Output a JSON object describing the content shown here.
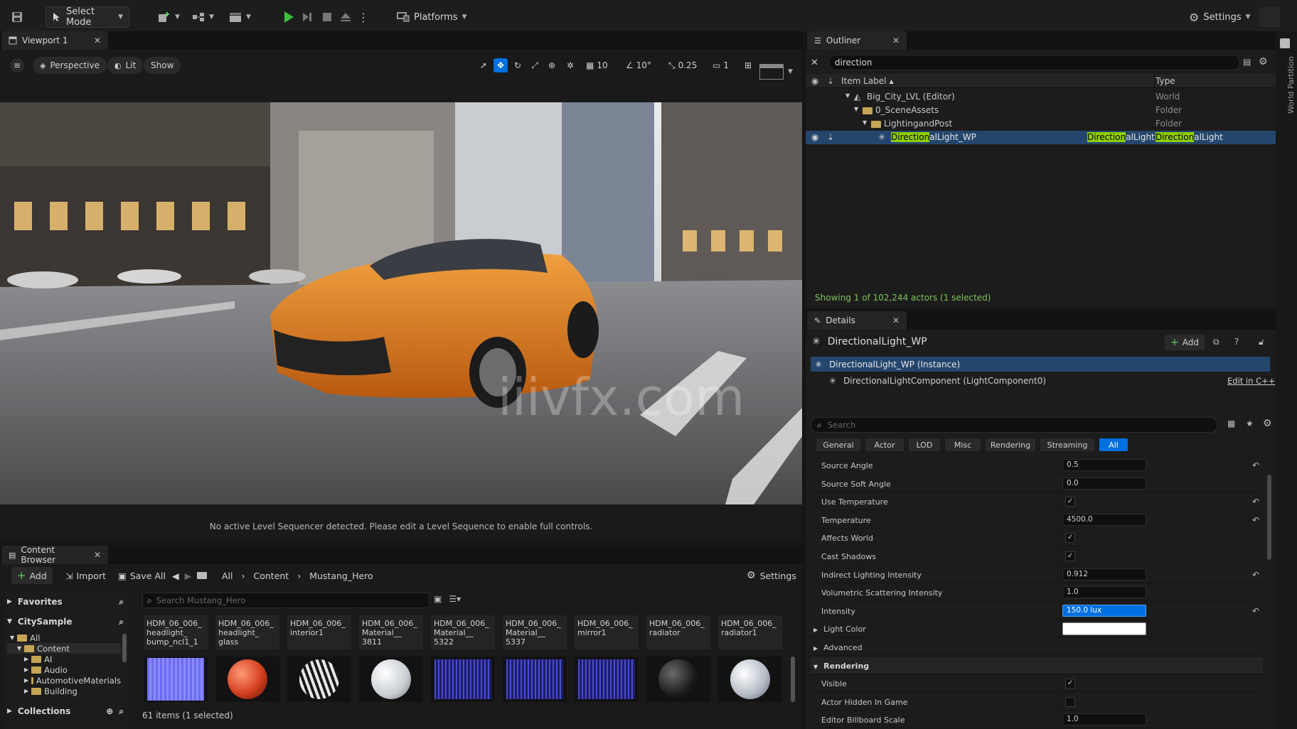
{
  "toolbar": {
    "select_mode": "Select Mode",
    "platforms": "Platforms",
    "settings": "Settings"
  },
  "viewport": {
    "tab": "Viewport 1",
    "perspective": "Perspective",
    "lit": "Lit",
    "show": "Show",
    "grid_snap": "10",
    "angle_snap": "10°",
    "scale_snap": "0.25",
    "camera_speed": "1",
    "watermark": "iiivfx.com",
    "message": "No active Level Sequencer detected. Please edit a Level Sequence to enable full controls."
  },
  "content_browser": {
    "tab": "Content Browser",
    "add": "Add",
    "import": "Import",
    "save_all": "Save All",
    "breadcrumb": [
      "All",
      "Content",
      "Mustang_Hero"
    ],
    "settings": "Settings",
    "favorites": "Favorites",
    "project": "CitySample",
    "search_placeholder": "Search Mustang_Hero",
    "tree": [
      "All",
      "Content",
      "AI",
      "Audio",
      "AutomotiveMaterials",
      "Building"
    ],
    "collections": "Collections",
    "status": "61 items (1 selected)",
    "assets": [
      {
        "label": "HDM_06_006_ headlight_ bump_ncl1_1",
        "thumb": "blue-tex"
      },
      {
        "label": "HDM_06_006_ headlight_ glass",
        "thumb": "red-sphere"
      },
      {
        "label": "HDM_06_006_ interior1",
        "thumb": "pattern-sphere"
      },
      {
        "label": "HDM_06_006_ Material__ 3811",
        "thumb": "white-sphere"
      },
      {
        "label": "HDM_06_006_ Material__ 5322",
        "thumb": "grid-tex"
      },
      {
        "label": "HDM_06_006_ Material__ 5337",
        "thumb": "grid-tex"
      },
      {
        "label": "HDM_06_006_ mirror1",
        "thumb": "grid-tex"
      },
      {
        "label": "HDM_06_006_ radiator",
        "thumb": "dark-sphere"
      },
      {
        "label": "HDM_06_006_ radiator1",
        "thumb": "grey-sphere"
      }
    ]
  },
  "outliner": {
    "tab": "Outliner",
    "search_value": "direction",
    "col_label": "Item Label",
    "col_type": "Type",
    "rows": [
      {
        "label": "Big_City_LVL (Editor)",
        "type": "World"
      },
      {
        "label": "0_SceneAssets",
        "type": "Folder"
      },
      {
        "label": "LightingandPost",
        "type": "Folder"
      }
    ],
    "selected": {
      "label_match": "Direction",
      "label_rest": "alLight_WP",
      "col2_match": "Direction",
      "col2_rest": "alLight",
      "type_match": "Direction",
      "type_rest": "alLight"
    },
    "status": "Showing 1 of 102,244 actors (1 selected)"
  },
  "details": {
    "tab": "Details",
    "actor": "DirectionalLight_WP",
    "add": "Add",
    "instance": "DirectionalLight_WP (Instance)",
    "component": "DirectionalLightComponent (LightComponent0)",
    "edit_cpp": "Edit in C++",
    "search_placeholder": "Search",
    "categories": [
      "General",
      "Actor",
      "LOD",
      "Misc",
      "Rendering",
      "Streaming",
      "All"
    ],
    "properties": [
      {
        "name": "Source Angle",
        "kind": "value",
        "value": "0.5",
        "reset": true
      },
      {
        "name": "Source Soft Angle",
        "kind": "value",
        "value": "0.0",
        "reset": false
      },
      {
        "name": "Use Temperature",
        "kind": "check",
        "value": "✓",
        "reset": true
      },
      {
        "name": "Temperature",
        "kind": "value",
        "value": "4500.0",
        "reset": true
      },
      {
        "name": "Affects World",
        "kind": "check",
        "value": "✓",
        "reset": false
      },
      {
        "name": "Cast Shadows",
        "kind": "check",
        "value": "✓",
        "reset": false
      },
      {
        "name": "Indirect Lighting Intensity",
        "kind": "value",
        "value": "0.912",
        "reset": true
      },
      {
        "name": "Volumetric Scattering Intensity",
        "kind": "value",
        "value": "1.0",
        "reset": false
      },
      {
        "name": "Intensity",
        "kind": "active",
        "value": "150.0 lux",
        "reset": true
      },
      {
        "name": "Light Color",
        "kind": "color",
        "value": "",
        "reset": false
      },
      {
        "name": "Advanced",
        "kind": "section",
        "value": "",
        "reset": false
      },
      {
        "name": "Rendering",
        "kind": "header",
        "value": "",
        "reset": false
      },
      {
        "name": "Visible",
        "kind": "check",
        "value": "✓",
        "reset": false
      },
      {
        "name": "Actor Hidden In Game",
        "kind": "check",
        "value": "",
        "reset": false
      },
      {
        "name": "Editor Billboard Scale",
        "kind": "value",
        "value": "1.0",
        "reset": false
      }
    ]
  },
  "world_partition": "World Partition",
  "colors": {
    "accent": "#0070e0",
    "highlight": "#8fcf00",
    "selected_row": "#24466d",
    "play_green": "#3fbf3f"
  }
}
